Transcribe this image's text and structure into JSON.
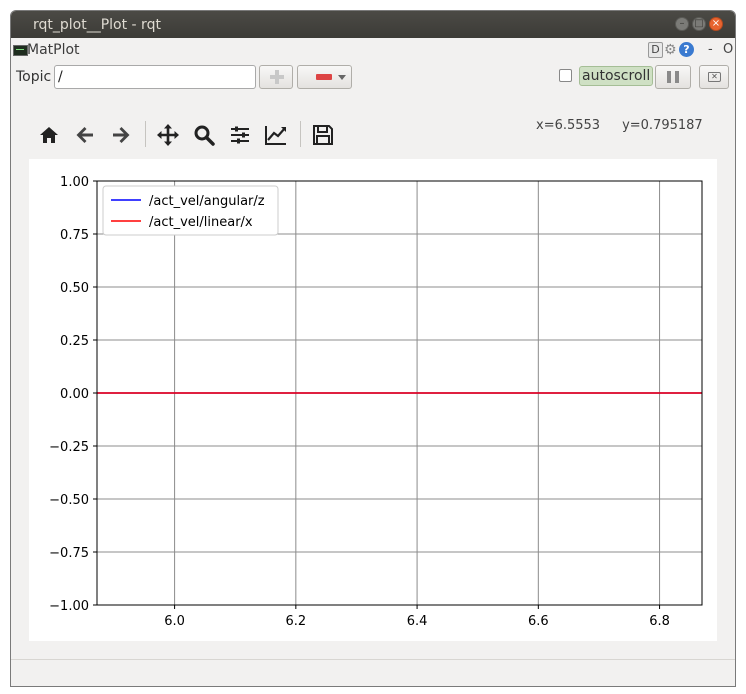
{
  "window": {
    "title": "rqt_plot__Plot - rqt",
    "minimize_glyph": "–",
    "maximize_glyph": "□",
    "close_glyph": "×"
  },
  "plugin": {
    "name": "MatPlot",
    "header_right": {
      "d_label": "D",
      "help_glyph": "?",
      "dash": "-",
      "o": "O"
    }
  },
  "topic": {
    "label": "Topic",
    "value": "/"
  },
  "controls": {
    "autoscroll_label": "autoscroll",
    "autoscroll_checked": false,
    "clear_glyph": "✕"
  },
  "toolbar": {
    "icons": [
      "home-icon",
      "back-arrow-icon",
      "forward-arrow-icon",
      "pan-icon",
      "zoom-icon",
      "subplot-config-icon",
      "axes-edit-icon",
      "save-icon"
    ]
  },
  "coords": {
    "x": "x=6.5553",
    "y": "y=0.795187"
  },
  "chart_data": {
    "type": "line",
    "title": "",
    "xlabel": "",
    "ylabel": "",
    "xlim": [
      5.872,
      6.87
    ],
    "ylim": [
      -1.0,
      1.0
    ],
    "xticks": [
      "6.0",
      "6.2",
      "6.4",
      "6.6",
      "6.8"
    ],
    "xtick_values": [
      6.0,
      6.2,
      6.4,
      6.6,
      6.8
    ],
    "yticks": [
      "1.00",
      "0.75",
      "0.50",
      "0.25",
      "0.00",
      "−0.25",
      "−0.50",
      "−0.75",
      "−1.00"
    ],
    "ytick_values": [
      1.0,
      0.75,
      0.5,
      0.25,
      0.0,
      -0.25,
      -0.5,
      -0.75,
      -1.0
    ],
    "grid": true,
    "legend_position": "top-left",
    "series": [
      {
        "name": "/act_vel/angular/z",
        "color": "#0000ff",
        "x": [
          5.872,
          6.87
        ],
        "y": [
          0.0,
          0.0
        ]
      },
      {
        "name": "/act_vel/linear/x",
        "color": "#ff0000",
        "x": [
          5.872,
          6.87
        ],
        "y": [
          0.0,
          0.0
        ]
      }
    ]
  }
}
